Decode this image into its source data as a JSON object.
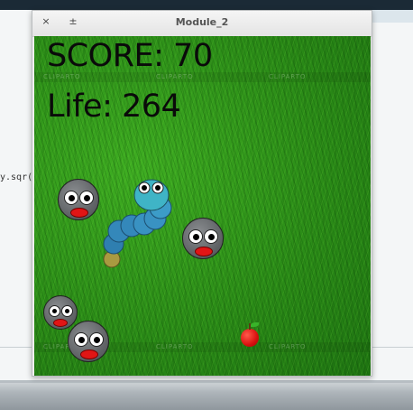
{
  "window": {
    "title": "Module_2",
    "close_label": "×",
    "pin_label": "±"
  },
  "background": {
    "code_snippet": "y.sqr("
  },
  "hud": {
    "score_text": "SCORE: 70",
    "life_text": "Life: 264"
  },
  "watermark": {
    "text": "CLIPARTO"
  },
  "sprites": {
    "player": "blue-snake",
    "enemies": [
      "gray-blob",
      "gray-blob",
      "gray-blob",
      "gray-blob"
    ],
    "food": "red-apple"
  },
  "colors": {
    "grass": "#2a8a17",
    "snake_body": "#3b8cbc",
    "snake_head": "#3fb4c6",
    "snake_tail": "#a89a40",
    "enemy": "#6a6d70",
    "enemy_mouth": "#e11515",
    "apple": "#d80f0f"
  }
}
